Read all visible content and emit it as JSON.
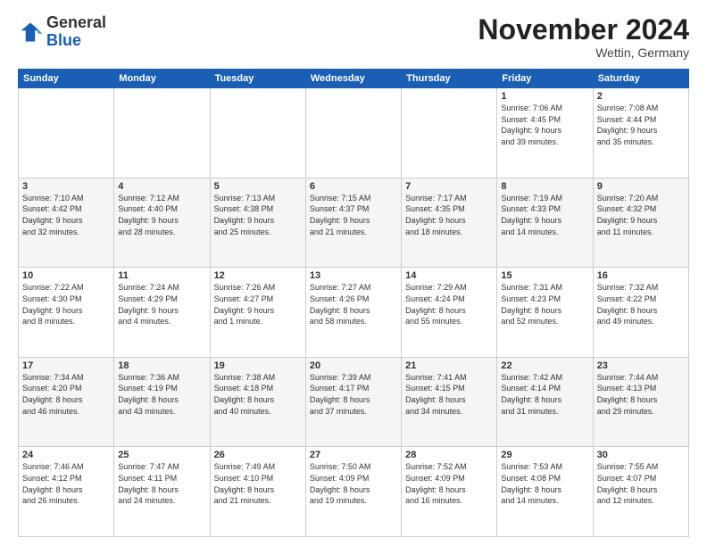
{
  "header": {
    "logo": {
      "general": "General",
      "blue": "Blue"
    },
    "title": "November 2024",
    "location": "Wettin, Germany"
  },
  "weekdays": [
    "Sunday",
    "Monday",
    "Tuesday",
    "Wednesday",
    "Thursday",
    "Friday",
    "Saturday"
  ],
  "weeks": [
    [
      {
        "day": "",
        "info": ""
      },
      {
        "day": "",
        "info": ""
      },
      {
        "day": "",
        "info": ""
      },
      {
        "day": "",
        "info": ""
      },
      {
        "day": "",
        "info": ""
      },
      {
        "day": "1",
        "info": "Sunrise: 7:06 AM\nSunset: 4:45 PM\nDaylight: 9 hours\nand 39 minutes."
      },
      {
        "day": "2",
        "info": "Sunrise: 7:08 AM\nSunset: 4:44 PM\nDaylight: 9 hours\nand 35 minutes."
      }
    ],
    [
      {
        "day": "3",
        "info": "Sunrise: 7:10 AM\nSunset: 4:42 PM\nDaylight: 9 hours\nand 32 minutes."
      },
      {
        "day": "4",
        "info": "Sunrise: 7:12 AM\nSunset: 4:40 PM\nDaylight: 9 hours\nand 28 minutes."
      },
      {
        "day": "5",
        "info": "Sunrise: 7:13 AM\nSunset: 4:38 PM\nDaylight: 9 hours\nand 25 minutes."
      },
      {
        "day": "6",
        "info": "Sunrise: 7:15 AM\nSunset: 4:37 PM\nDaylight: 9 hours\nand 21 minutes."
      },
      {
        "day": "7",
        "info": "Sunrise: 7:17 AM\nSunset: 4:35 PM\nDaylight: 9 hours\nand 18 minutes."
      },
      {
        "day": "8",
        "info": "Sunrise: 7:19 AM\nSunset: 4:33 PM\nDaylight: 9 hours\nand 14 minutes."
      },
      {
        "day": "9",
        "info": "Sunrise: 7:20 AM\nSunset: 4:32 PM\nDaylight: 9 hours\nand 11 minutes."
      }
    ],
    [
      {
        "day": "10",
        "info": "Sunrise: 7:22 AM\nSunset: 4:30 PM\nDaylight: 9 hours\nand 8 minutes."
      },
      {
        "day": "11",
        "info": "Sunrise: 7:24 AM\nSunset: 4:29 PM\nDaylight: 9 hours\nand 4 minutes."
      },
      {
        "day": "12",
        "info": "Sunrise: 7:26 AM\nSunset: 4:27 PM\nDaylight: 9 hours\nand 1 minute."
      },
      {
        "day": "13",
        "info": "Sunrise: 7:27 AM\nSunset: 4:26 PM\nDaylight: 8 hours\nand 58 minutes."
      },
      {
        "day": "14",
        "info": "Sunrise: 7:29 AM\nSunset: 4:24 PM\nDaylight: 8 hours\nand 55 minutes."
      },
      {
        "day": "15",
        "info": "Sunrise: 7:31 AM\nSunset: 4:23 PM\nDaylight: 8 hours\nand 52 minutes."
      },
      {
        "day": "16",
        "info": "Sunrise: 7:32 AM\nSunset: 4:22 PM\nDaylight: 8 hours\nand 49 minutes."
      }
    ],
    [
      {
        "day": "17",
        "info": "Sunrise: 7:34 AM\nSunset: 4:20 PM\nDaylight: 8 hours\nand 46 minutes."
      },
      {
        "day": "18",
        "info": "Sunrise: 7:36 AM\nSunset: 4:19 PM\nDaylight: 8 hours\nand 43 minutes."
      },
      {
        "day": "19",
        "info": "Sunrise: 7:38 AM\nSunset: 4:18 PM\nDaylight: 8 hours\nand 40 minutes."
      },
      {
        "day": "20",
        "info": "Sunrise: 7:39 AM\nSunset: 4:17 PM\nDaylight: 8 hours\nand 37 minutes."
      },
      {
        "day": "21",
        "info": "Sunrise: 7:41 AM\nSunset: 4:15 PM\nDaylight: 8 hours\nand 34 minutes."
      },
      {
        "day": "22",
        "info": "Sunrise: 7:42 AM\nSunset: 4:14 PM\nDaylight: 8 hours\nand 31 minutes."
      },
      {
        "day": "23",
        "info": "Sunrise: 7:44 AM\nSunset: 4:13 PM\nDaylight: 8 hours\nand 29 minutes."
      }
    ],
    [
      {
        "day": "24",
        "info": "Sunrise: 7:46 AM\nSunset: 4:12 PM\nDaylight: 8 hours\nand 26 minutes."
      },
      {
        "day": "25",
        "info": "Sunrise: 7:47 AM\nSunset: 4:11 PM\nDaylight: 8 hours\nand 24 minutes."
      },
      {
        "day": "26",
        "info": "Sunrise: 7:49 AM\nSunset: 4:10 PM\nDaylight: 8 hours\nand 21 minutes."
      },
      {
        "day": "27",
        "info": "Sunrise: 7:50 AM\nSunset: 4:09 PM\nDaylight: 8 hours\nand 19 minutes."
      },
      {
        "day": "28",
        "info": "Sunrise: 7:52 AM\nSunset: 4:09 PM\nDaylight: 8 hours\nand 16 minutes."
      },
      {
        "day": "29",
        "info": "Sunrise: 7:53 AM\nSunset: 4:08 PM\nDaylight: 8 hours\nand 14 minutes."
      },
      {
        "day": "30",
        "info": "Sunrise: 7:55 AM\nSunset: 4:07 PM\nDaylight: 8 hours\nand 12 minutes."
      }
    ]
  ]
}
